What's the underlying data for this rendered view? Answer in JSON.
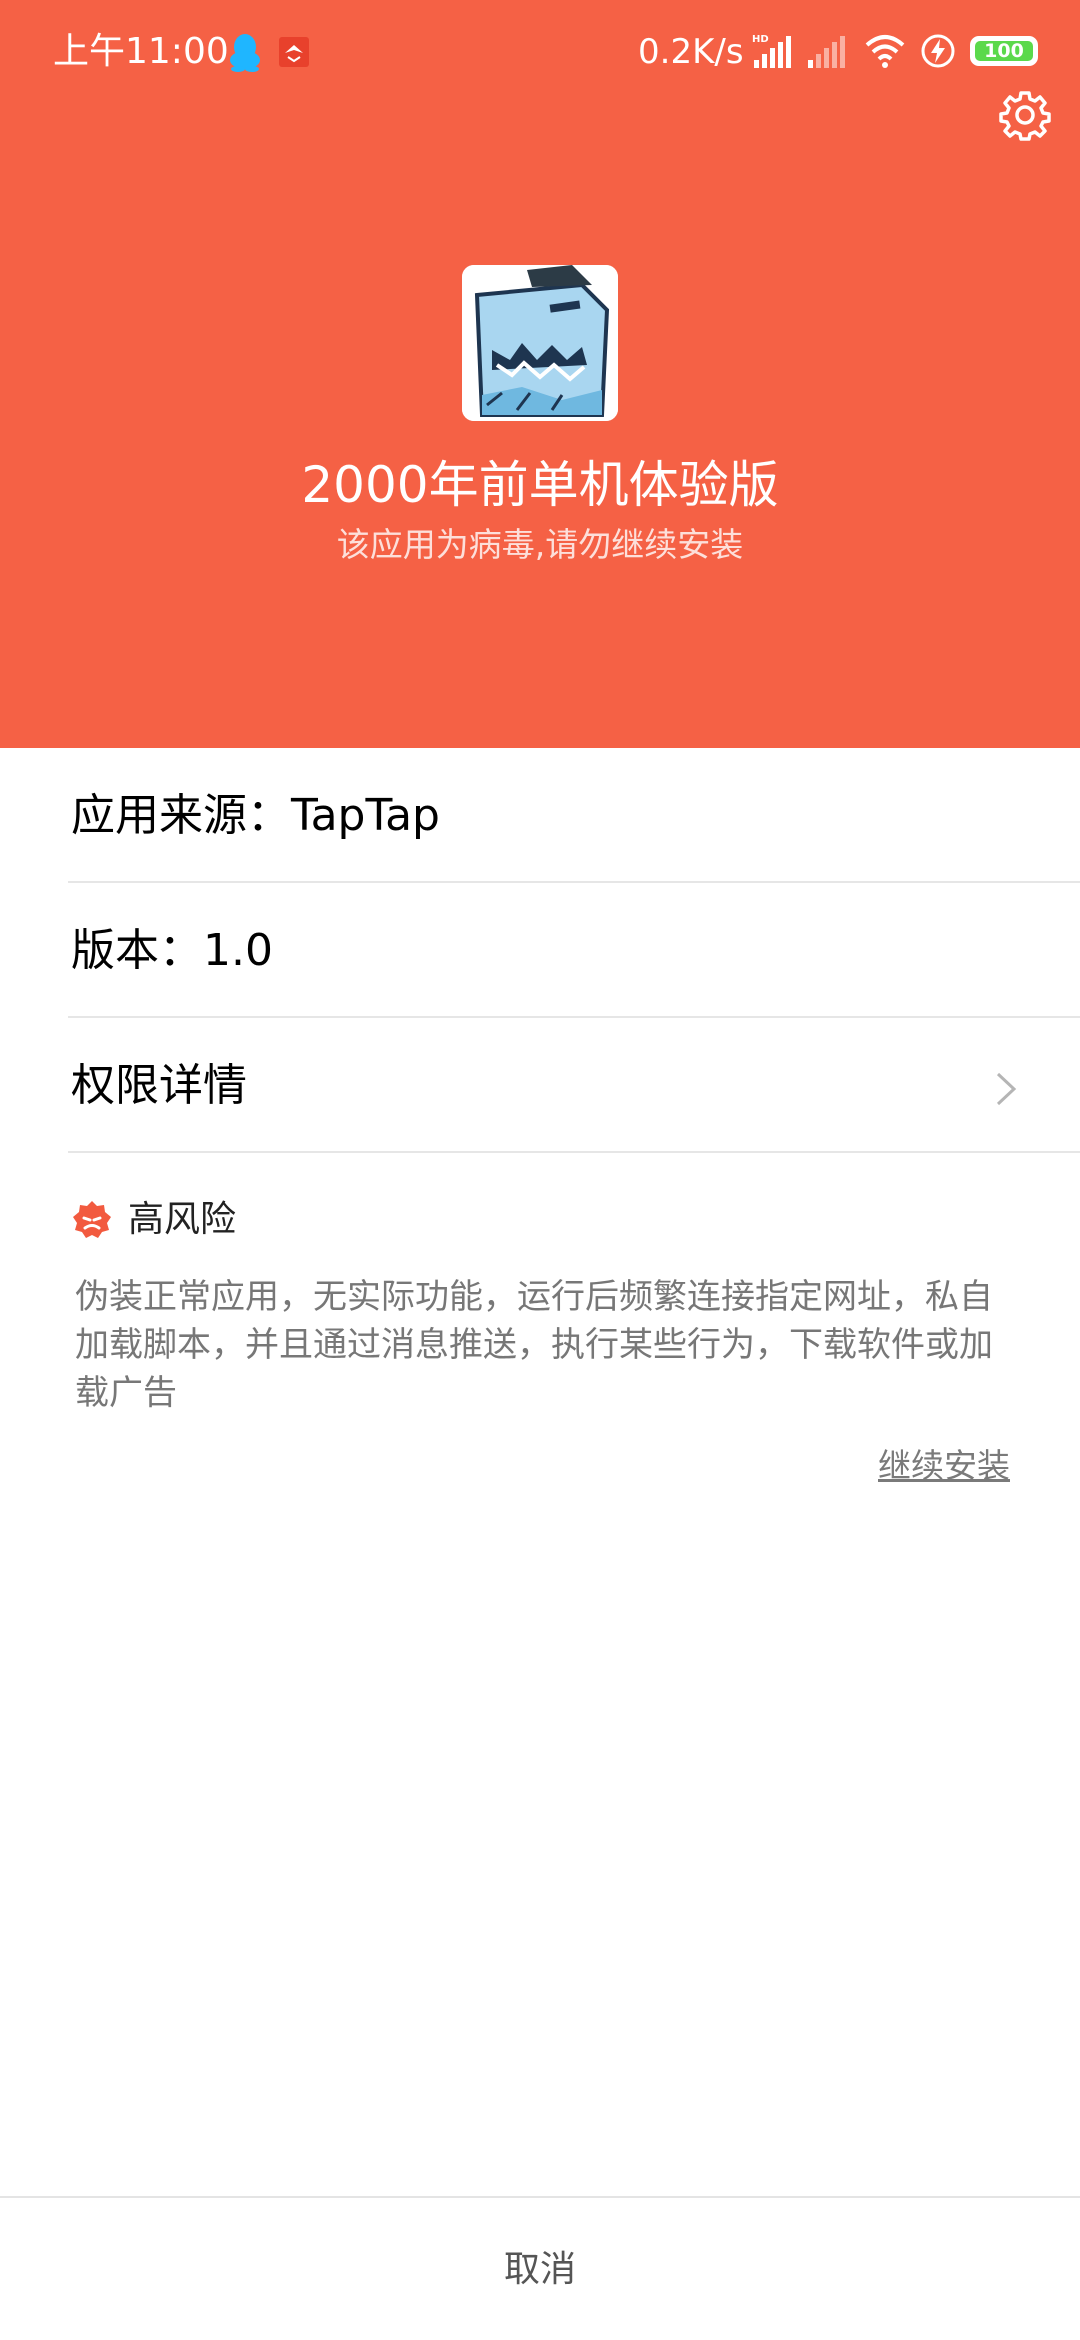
{
  "status_bar": {
    "time": "上午11:00",
    "net_speed": "0.2K/s",
    "signal_label": "HD",
    "battery": "100",
    "icons": [
      "qq-icon",
      "notification-icon",
      "signal-icon",
      "signal-icon",
      "wifi-icon",
      "charging-icon",
      "battery-icon"
    ]
  },
  "header": {
    "settings_icon": "gear-icon",
    "app_name": "2000年前单机体验版",
    "warning": "该应用为病毒,请勿继续安装"
  },
  "info": {
    "source": "应用来源：TapTap",
    "version": "版本：1.0",
    "permissions": "权限详情"
  },
  "risk": {
    "label": "高风险",
    "description": "伪装正常应用，无实际功能，运行后频繁连接指定网址，私自加载脚本，并且通过消息推送，执行某些行为，下载软件或加载广告",
    "continue_install": "继续安装"
  },
  "footer": {
    "cancel": "取消"
  },
  "colors": {
    "header_bg": "#f56145",
    "risk_icon": "#f25a3f",
    "battery_fill": "#5bd94b"
  }
}
